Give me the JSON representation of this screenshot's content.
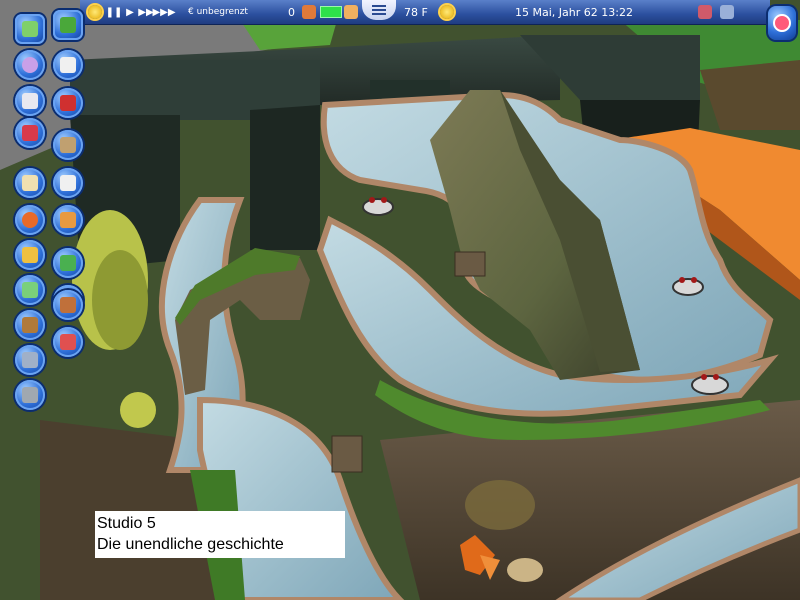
{
  "topbar": {
    "speed_controls": [
      "pause",
      "play",
      "fast-forward",
      "fastest"
    ],
    "money": "€ unbegrenzt",
    "guest_count": "0",
    "temperature": "78 F",
    "date_time": "15 Mai, Jahr 62   13:22"
  },
  "left_toolbar": {
    "column1_icons": [
      "park-overview-icon",
      "guests-icon",
      "finance-icon",
      "research-icon",
      "objectives-icon",
      "staff-icon",
      "rides-icon",
      "map-icon",
      "scenery-icon",
      "path-icon",
      "trash-icon"
    ],
    "column2_icons": [
      "tree-icon",
      "fence-icon",
      "wall-icon",
      "shop-icon",
      "dice-icon",
      "terrain-icon",
      "landscape-icon",
      "water-icon",
      "chest-icon",
      "paint-icon"
    ]
  },
  "caption": {
    "line1": "Studio 5",
    "line2": "Die unendliche geschichte"
  },
  "colors": {
    "toolbar_blue": "#2e6fd8",
    "topbar_blue": "#2b4f9e",
    "water": "#9fc0cf",
    "grass": "#4f8a2d",
    "rock": "#27302a"
  }
}
